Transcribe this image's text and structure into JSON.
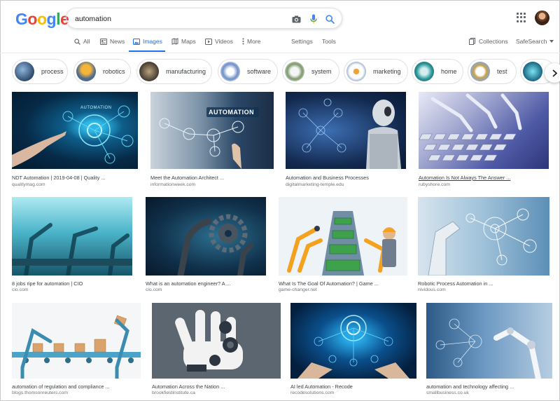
{
  "header": {
    "logo": [
      "G",
      "o",
      "o",
      "g",
      "l",
      "e"
    ],
    "logo_colors": [
      "#4285f4",
      "#ea4335",
      "#fbbc05",
      "#4285f4",
      "#34a853",
      "#ea4335"
    ],
    "search_value": "automation"
  },
  "tabs": {
    "all": "All",
    "news": "News",
    "images": "Images",
    "maps": "Maps",
    "videos": "Videos",
    "more": "More",
    "settings": "Settings",
    "tools": "Tools",
    "collections": "Collections",
    "safesearch": "SafeSearch"
  },
  "chips": [
    "process",
    "robotics",
    "manufacturing",
    "software",
    "system",
    "marketing",
    "home",
    "test"
  ],
  "results": [
    {
      "title": "NDT Automation | 2019-04-08 | Quality ...",
      "source": "qualitymag.com"
    },
    {
      "title": "Meet the Automation Architect ...",
      "source": "informationweek.com"
    },
    {
      "title": "Automation and Business Processes",
      "source": "digitalmarketing-temple.edu"
    },
    {
      "title": "Automation Is Not Always The Answer ...",
      "source": "rubyshore.com"
    },
    {
      "title": "8 jobs ripe for automation | CIO",
      "source": "cio.com"
    },
    {
      "title": "What is an automation engineer? A ...",
      "source": "cio.com"
    },
    {
      "title": "What Is The Goal Of Automation? | Game ...",
      "source": "game-changer.net"
    },
    {
      "title": "Robotic Process Automation in ...",
      "source": "nividous.com"
    },
    {
      "title": "automation of regulation and compliance ...",
      "source": "blogs.thomsonreuters.com"
    },
    {
      "title": "Automation Across the Nation ...",
      "source": "brookfieldinstitute.ca"
    },
    {
      "title": "AI led Automation - Recode",
      "source": "recodesolutions.com"
    },
    {
      "title": "automation and technology affecting ...",
      "source": "smallbusiness.co.uk"
    }
  ],
  "image_text": {
    "r1": "AUTOMATION",
    "r2": "AUTOMATION"
  }
}
